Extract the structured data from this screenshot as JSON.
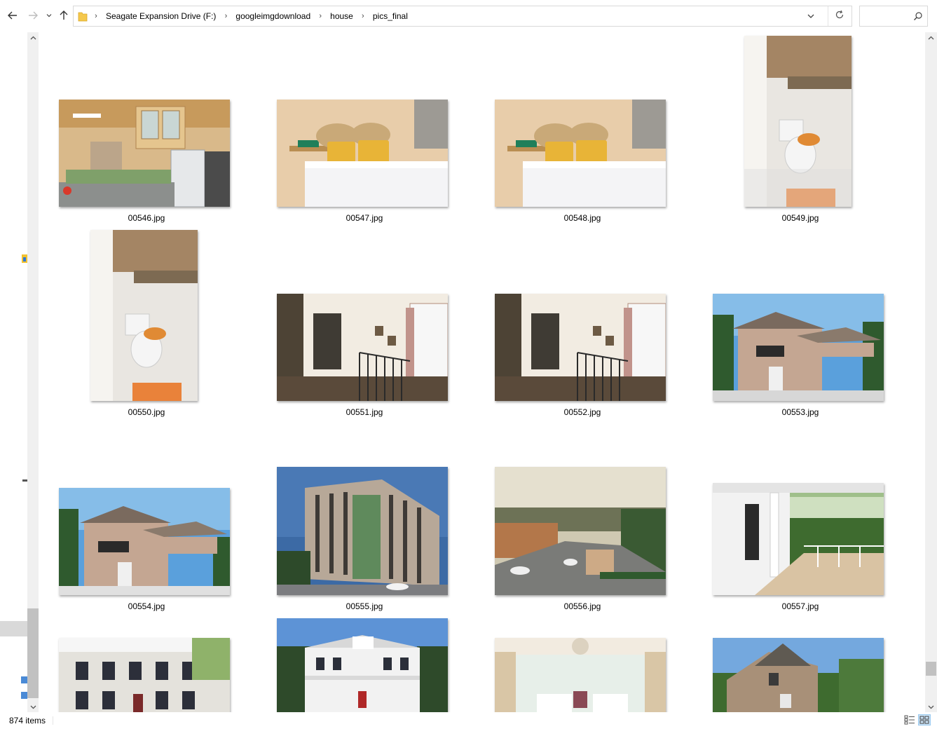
{
  "address_bar": {
    "breadcrumbs": [
      "Seagate Expansion Drive (F:)",
      "googleimgdownload",
      "house",
      "pics_final"
    ],
    "search_placeholder": ""
  },
  "icons": {
    "back": "arrow-left-icon",
    "forward": "arrow-right-icon",
    "recent": "chevron-down-icon",
    "up": "arrow-up-icon",
    "folder": "folder-icon",
    "history": "chevron-down-icon",
    "refresh": "refresh-icon",
    "search": "search-icon",
    "details_view": "details-view-icon",
    "large_icons_view": "large-icons-view-icon"
  },
  "files": [
    {
      "name": "00546.jpg",
      "scene": "kitchen"
    },
    {
      "name": "00547.jpg",
      "scene": "bedroom"
    },
    {
      "name": "00548.jpg",
      "scene": "bedroom"
    },
    {
      "name": "00549.jpg",
      "scene": "bathroom"
    },
    {
      "name": "00550.jpg",
      "scene": "bathroom"
    },
    {
      "name": "00551.jpg",
      "scene": "hallway"
    },
    {
      "name": "00552.jpg",
      "scene": "hallway"
    },
    {
      "name": "00553.jpg",
      "scene": "house"
    },
    {
      "name": "00554.jpg",
      "scene": "house"
    },
    {
      "name": "00555.jpg",
      "scene": "condo"
    },
    {
      "name": "00556.jpg",
      "scene": "subdivision"
    },
    {
      "name": "00557.jpg",
      "scene": "porch"
    },
    {
      "name": "",
      "scene": "colonial"
    },
    {
      "name": "",
      "scene": "farmhouse"
    },
    {
      "name": "",
      "scene": "livingroom"
    },
    {
      "name": "",
      "scene": "cottage"
    }
  ],
  "status": {
    "item_count": "874 items"
  }
}
